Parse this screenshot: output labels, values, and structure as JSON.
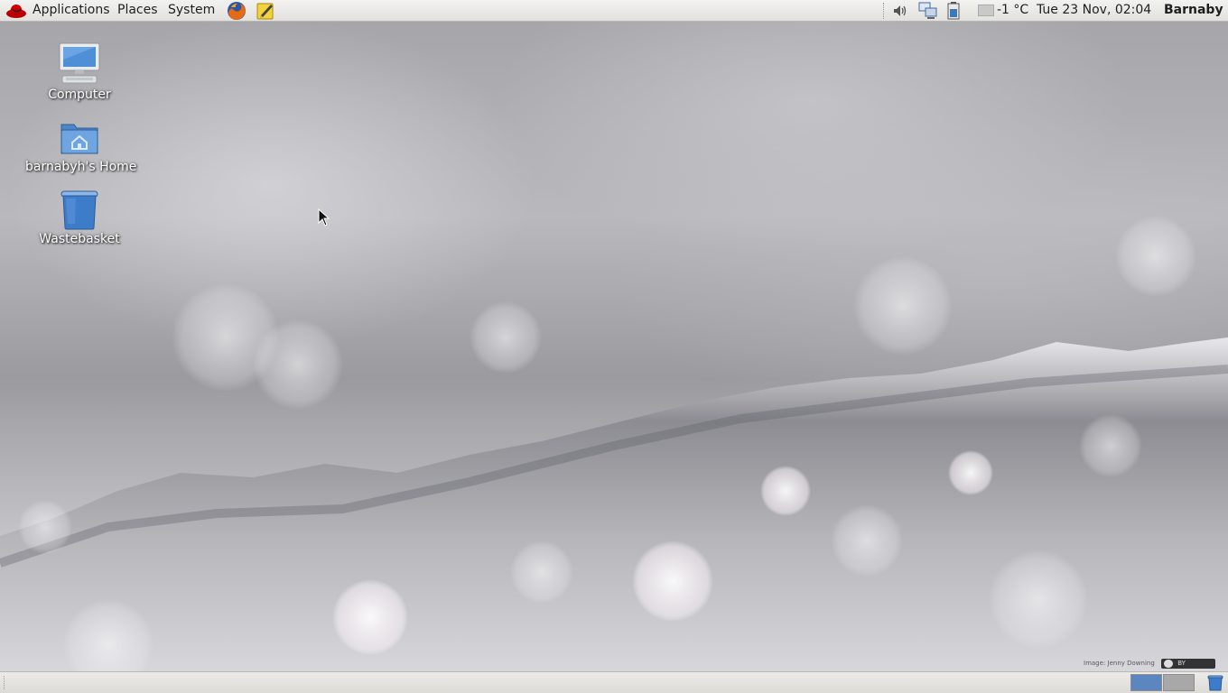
{
  "top_panel": {
    "menus": {
      "applications": "Applications",
      "places": "Places",
      "system": "System"
    },
    "launchers": [
      "firefox-icon",
      "text-editor-icon"
    ],
    "tray": {
      "icons": [
        "volume-icon",
        "network-icon",
        "battery-icon",
        "weather-icon"
      ],
      "weather": "-1 °C",
      "clock": "Tue 23 Nov, 02:04",
      "user": "Barnaby"
    }
  },
  "desktop": {
    "icons": [
      {
        "label": "Computer",
        "icon": "computer-icon"
      },
      {
        "label": "barnabyh's Home",
        "icon": "home-folder-icon"
      },
      {
        "label": "Wastebasket",
        "icon": "wastebasket-icon"
      }
    ],
    "wallpaper_credit": "Image: Jenny Downing",
    "license_badge": "BY"
  },
  "bottom_panel": {
    "workspaces": 2,
    "active_workspace": 1,
    "trash_applet": "trash-applet-icon"
  },
  "colors": {
    "workspace_active": "#5b86c0",
    "workspace_inactive": "#a8a8a8",
    "icon_blue": "#3d7cc9"
  }
}
